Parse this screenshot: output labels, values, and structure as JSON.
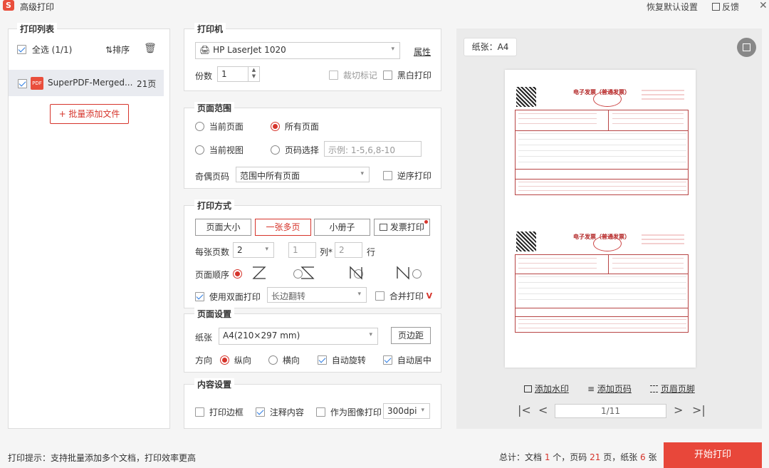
{
  "app": {
    "title": "高级打印",
    "restore_defaults": "恢复默认设置",
    "feedback": "反馈"
  },
  "left": {
    "title": "打印列表",
    "select_all": "全选 (1/1)",
    "sort": "排序",
    "file": {
      "name": "SuperPDF-Merged...",
      "pages": "21页",
      "badge": "PDF"
    },
    "add_button": "+ 批量添加文件"
  },
  "printer": {
    "title": "打印机",
    "name": "HP LaserJet 1020",
    "properties": "属性",
    "copies_label": "份数",
    "copies_value": "1",
    "crop_marks": "裁切标记",
    "bw_print": "黑白打印"
  },
  "range": {
    "title": "页面范围",
    "current_page": "当前页面",
    "all_pages": "所有页面",
    "current_view": "当前视图",
    "page_select": "页码选择",
    "page_select_placeholder": "示例: 1-5,6,8-10",
    "odd_even_label": "奇偶页码",
    "odd_even_value": "范围中所有页面",
    "reverse": "逆序打印"
  },
  "mode": {
    "title": "打印方式",
    "btn_page_size": "页面大小",
    "btn_multi": "一张多页",
    "btn_booklet": "小册子",
    "btn_invoice": "发票打印",
    "per_sheet_label": "每张页数",
    "per_sheet_value": "2",
    "cols_value": "1",
    "cols_label": "列*",
    "rows_value": "2",
    "rows_label": "行",
    "order_label": "页面顺序",
    "duplex": "使用双面打印",
    "duplex_value": "长边翻转",
    "merge": "合并打印"
  },
  "page_setup": {
    "title": "页面设置",
    "paper_label": "纸张",
    "paper_value": "A4(210×297 mm)",
    "margins": "页边距",
    "orient_label": "方向",
    "portrait": "纵向",
    "landscape": "横向",
    "auto_rotate": "自动旋转",
    "auto_center": "自动居中"
  },
  "content": {
    "title": "内容设置",
    "print_border": "打印边框",
    "annotations": "注释内容",
    "as_image": "作为图像打印",
    "dpi": "300dpi"
  },
  "preview": {
    "paper_tag": "纸张：A4",
    "invoice_title": "电子发票（普通发票）",
    "add_watermark": "添加水印",
    "add_page_number": "添加页码",
    "header_footer": "页眉页脚",
    "page_indicator": "1/11"
  },
  "footer": {
    "tip": "打印提示：支持批量添加多个文档，打印效率更高",
    "summary_prefix": "总计：文档 ",
    "doc_count": "1",
    "summary_mid1": " 个，页码 ",
    "page_count": "21",
    "summary_mid2": " 页，纸张 ",
    "sheet_count": "6",
    "summary_suffix": " 张",
    "start_print": "开始打印"
  },
  "colors": {
    "accent": "#d6342b",
    "start_button": "#e8473a",
    "check": "#2a7ae2"
  }
}
